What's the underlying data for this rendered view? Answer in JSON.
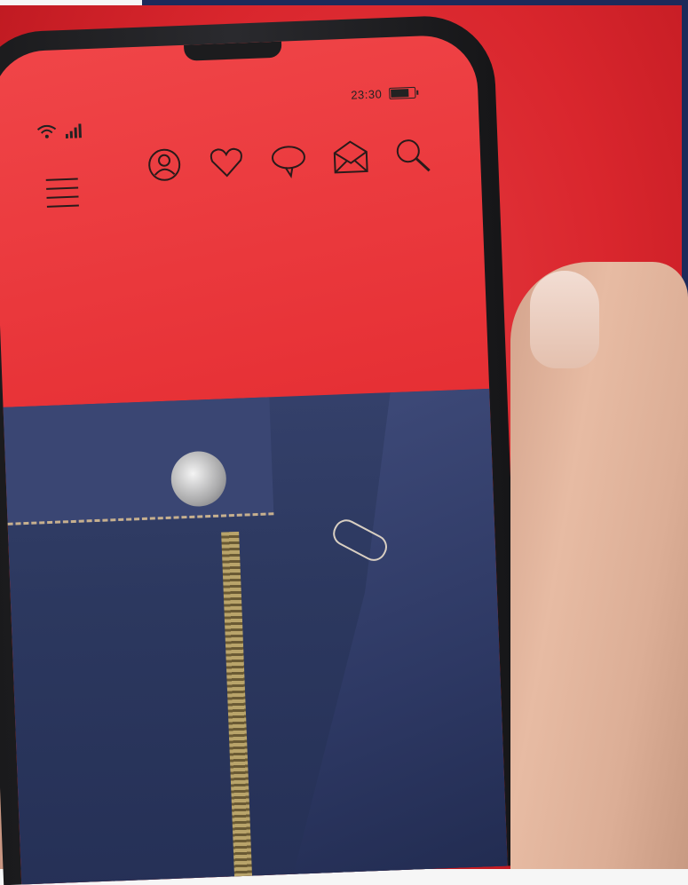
{
  "status_bar": {
    "time": "23:30",
    "battery_level": 0.7
  },
  "icons": {
    "wifi": "wifi-icon",
    "signal": "signal-icon",
    "menu": "menu-icon",
    "profile": "profile-icon",
    "favorites": "heart-icon",
    "chat": "chat-bubble-icon",
    "mail": "mail-icon",
    "search": "search-icon"
  },
  "colors": {
    "background_red": "#d9262d",
    "screen_red": "#e52e33",
    "denim": "#2c385f",
    "frame_navy": "#1d2a5a"
  }
}
